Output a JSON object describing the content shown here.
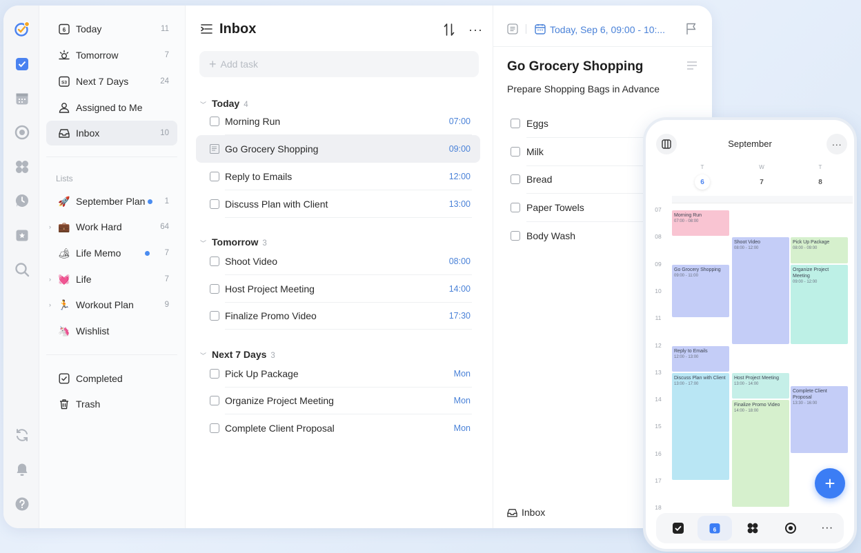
{
  "sidebar": {
    "smart": [
      {
        "label": "Today",
        "count": "11"
      },
      {
        "label": "Tomorrow",
        "count": "7"
      },
      {
        "label": "Next 7 Days",
        "count": "24"
      },
      {
        "label": "Assigned to Me",
        "count": ""
      },
      {
        "label": "Inbox",
        "count": "10"
      }
    ],
    "lists_label": "Lists",
    "lists": [
      {
        "emoji": "🚀",
        "label": "September Plan",
        "count": "1"
      },
      {
        "emoji": "💼",
        "label": "Work Hard",
        "count": "64"
      },
      {
        "emoji": "🏕",
        "label": "Life Memo",
        "count": "7"
      },
      {
        "emoji": "💓",
        "label": "Life",
        "count": "7"
      },
      {
        "emoji": "🏃",
        "label": "Workout Plan",
        "count": "9"
      },
      {
        "emoji": "🦄",
        "label": "Wishlist",
        "count": ""
      }
    ],
    "bottom": [
      {
        "label": "Completed"
      },
      {
        "label": "Trash"
      }
    ],
    "today_icon_number": "6",
    "next7_icon_number": "S3"
  },
  "list": {
    "title": "Inbox",
    "add_placeholder": "Add task",
    "sections": [
      {
        "title": "Today",
        "count": "4",
        "tasks": [
          {
            "title": "Morning Run",
            "time": "07:00"
          },
          {
            "title": "Go Grocery Shopping",
            "time": "09:00"
          },
          {
            "title": "Reply to Emails",
            "time": "12:00"
          },
          {
            "title": "Discuss Plan with Client",
            "time": "13:00"
          }
        ]
      },
      {
        "title": "Tomorrow",
        "count": "3",
        "tasks": [
          {
            "title": "Shoot Video",
            "time": "08:00"
          },
          {
            "title": "Host Project Meeting",
            "time": "14:00"
          },
          {
            "title": "Finalize Promo Video",
            "time": "17:30"
          }
        ]
      },
      {
        "title": "Next 7 Days",
        "count": "3",
        "tasks": [
          {
            "title": "Pick Up Package",
            "time": "Mon"
          },
          {
            "title": "Organize Project Meeting",
            "time": "Mon"
          },
          {
            "title": "Complete Client Proposal",
            "time": "Mon"
          }
        ]
      }
    ]
  },
  "detail": {
    "date": "Today, Sep 6, 09:00 - 10:...",
    "title": "Go Grocery Shopping",
    "subtitle": "Prepare Shopping Bags in Advance",
    "items": [
      "Eggs",
      "Milk",
      "Bread",
      "Paper Towels",
      "Body Wash"
    ],
    "footer_list": "Inbox"
  },
  "phone": {
    "month": "September",
    "weekdays": [
      "T",
      "W",
      "T"
    ],
    "days": [
      "6",
      "7",
      "8"
    ],
    "hours": [
      "07",
      "08",
      "09",
      "10",
      "11",
      "12",
      "13",
      "14",
      "15",
      "16",
      "17",
      "18"
    ],
    "nav_calendar_day": "6",
    "events": [
      {
        "title": "Morning Run",
        "time": "07:00 - 08:00",
        "col": 0,
        "start": 7,
        "end": 8,
        "color": "#f9c4d2"
      },
      {
        "title": "Go Grocery Shopping",
        "time": "09:00 - 11:00",
        "col": 0,
        "start": 9,
        "end": 11,
        "color": "#c4cdf7"
      },
      {
        "title": "Reply to Emails",
        "time": "12:00 - 13:00",
        "col": 0,
        "start": 12,
        "end": 13,
        "color": "#c4cdf7"
      },
      {
        "title": "Discuss Plan with Client",
        "time": "13:00 - 17:00",
        "col": 0,
        "start": 13,
        "end": 17,
        "color": "#b9e6f4"
      },
      {
        "title": "Shoot Video",
        "time": "08:00 - 12:00",
        "col": 1,
        "start": 8,
        "end": 12,
        "color": "#c4cdf7"
      },
      {
        "title": "Host Project Meeting",
        "time": "13:00 - 14:00",
        "col": 1,
        "start": 13,
        "end": 14,
        "color": "#c5efe8"
      },
      {
        "title": "Finalize Promo Video",
        "time": "14:00 - 18:00",
        "col": 1,
        "start": 14,
        "end": 18,
        "color": "#d6f0cd"
      },
      {
        "title": "Pick Up Package",
        "time": "08:00 - 09:00",
        "col": 2,
        "start": 8,
        "end": 9,
        "color": "#d6f0cd"
      },
      {
        "title": "Organize Project Meeting",
        "time": "09:00 - 12:00",
        "col": 2,
        "start": 9,
        "end": 12,
        "color": "#bdf0e6"
      },
      {
        "title": "Complete Client Proposal",
        "time": "13:30 - 16:00",
        "col": 2,
        "start": 13.5,
        "end": 16,
        "color": "#c4cdf7"
      }
    ]
  },
  "colors": {
    "accent": "#4a82f0",
    "fab": "#3b7df5"
  }
}
